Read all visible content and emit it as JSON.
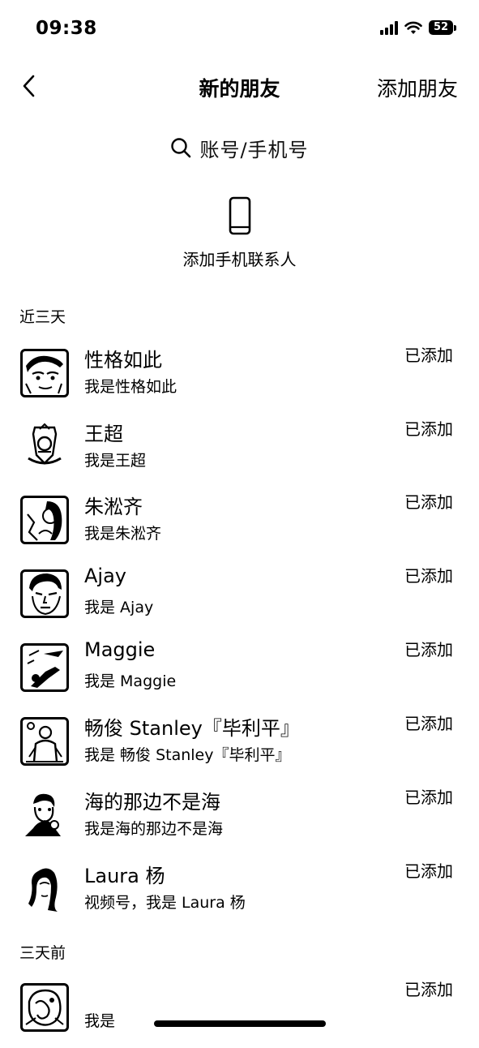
{
  "status_bar": {
    "time": "09:38",
    "battery": "52"
  },
  "nav": {
    "title": "新的朋友",
    "action": "添加朋友",
    "back_icon": "chevron-left-icon"
  },
  "search": {
    "placeholder": "账号/手机号",
    "icon": "search-icon"
  },
  "add_phone": {
    "label": "添加手机联系人",
    "icon": "phone-icon"
  },
  "sections": [
    {
      "title": "近三天",
      "items": [
        {
          "name": "性格如此",
          "message": "我是性格如此",
          "status": "已添加"
        },
        {
          "name": "王超",
          "message": "我是王超",
          "status": "已添加"
        },
        {
          "name": "朱淞齐",
          "message": "我是朱淞齐",
          "status": "已添加"
        },
        {
          "name": "Ajay",
          "message": "我是 Ajay",
          "status": "已添加"
        },
        {
          "name": "Maggie",
          "message": "我是 Maggie",
          "status": "已添加"
        },
        {
          "name": "畅俊 Stanley『毕利平』",
          "message": "我是 畅俊 Stanley『毕利平』",
          "status": "已添加"
        },
        {
          "name": "海的那边不是海",
          "message": "我是海的那边不是海",
          "status": "已添加"
        },
        {
          "name": "Laura 杨",
          "message": "视频号，我是 Laura 杨",
          "status": "已添加"
        }
      ]
    },
    {
      "title": "三天前",
      "items": [
        {
          "name": "",
          "message": "我是",
          "status": "已添加"
        }
      ]
    }
  ]
}
